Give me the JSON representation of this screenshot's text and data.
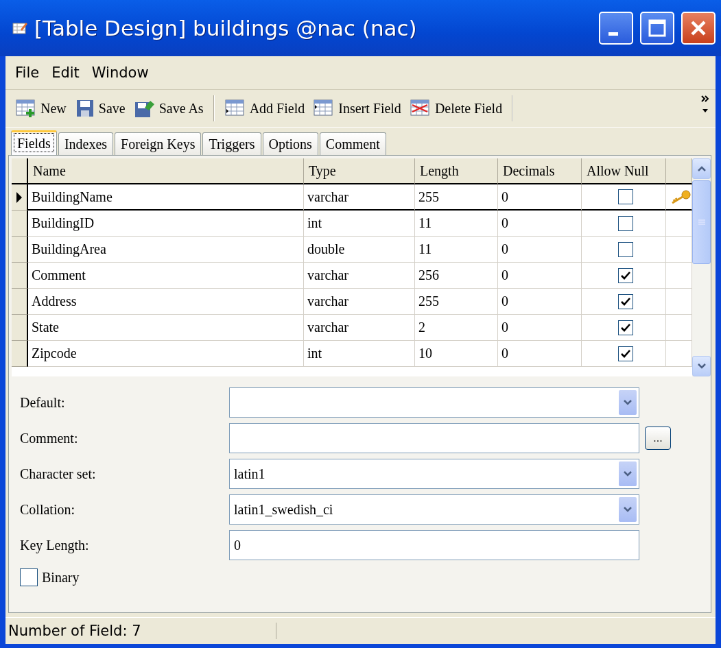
{
  "window": {
    "title": "[Table Design] buildings @nac (nac)"
  },
  "menu": [
    "File",
    "Edit",
    "Window"
  ],
  "toolbar": [
    {
      "label": "New",
      "kind": "new"
    },
    {
      "label": "Save",
      "kind": "save"
    },
    {
      "label": "Save As",
      "kind": "saveas"
    },
    {
      "label": "Add Field",
      "kind": "add"
    },
    {
      "label": "Insert Field",
      "kind": "insert"
    },
    {
      "label": "Delete Field",
      "kind": "delete"
    }
  ],
  "tabs": [
    {
      "label": "Fields",
      "selected": true
    },
    {
      "label": "Indexes",
      "selected": false
    },
    {
      "label": "Foreign Keys",
      "selected": false
    },
    {
      "label": "Triggers",
      "selected": false
    },
    {
      "label": "Options",
      "selected": false
    },
    {
      "label": "Comment",
      "selected": false
    }
  ],
  "table": {
    "columns": [
      "Name",
      "Type",
      "Length",
      "Decimals",
      "Allow Null"
    ],
    "rows": [
      {
        "name": "BuildingName",
        "type": "varchar",
        "length": "255",
        "decimals": "0",
        "allow_null": false,
        "primary_key": true,
        "selected": true
      },
      {
        "name": "BuildingID",
        "type": "int",
        "length": "11",
        "decimals": "0",
        "allow_null": false,
        "primary_key": false,
        "selected": false
      },
      {
        "name": "BuildingArea",
        "type": "double",
        "length": "11",
        "decimals": "0",
        "allow_null": false,
        "primary_key": false,
        "selected": false
      },
      {
        "name": "Comment",
        "type": "varchar",
        "length": "256",
        "decimals": "0",
        "allow_null": true,
        "primary_key": false,
        "selected": false
      },
      {
        "name": "Address",
        "type": "varchar",
        "length": "255",
        "decimals": "0",
        "allow_null": true,
        "primary_key": false,
        "selected": false
      },
      {
        "name": "State",
        "type": "varchar",
        "length": "2",
        "decimals": "0",
        "allow_null": true,
        "primary_key": false,
        "selected": false
      },
      {
        "name": "Zipcode",
        "type": "int",
        "length": "10",
        "decimals": "0",
        "allow_null": true,
        "primary_key": false,
        "selected": false
      }
    ]
  },
  "properties": [
    {
      "label": "Default:",
      "kind": "dropdown"
    },
    {
      "label": "Comment:",
      "kind": "text_more",
      "more": "..."
    },
    {
      "label": "Character set:",
      "kind": "dropdown",
      "value": "latin1"
    },
    {
      "label": "Collation:",
      "kind": "dropdown",
      "value": "latin1_swedish_ci"
    },
    {
      "label": "Key Length:",
      "kind": "text",
      "value": "0"
    }
  ],
  "binary": {
    "label": "Binary",
    "checked": false
  },
  "status_bar": {
    "text": "Number of Field: 7"
  }
}
